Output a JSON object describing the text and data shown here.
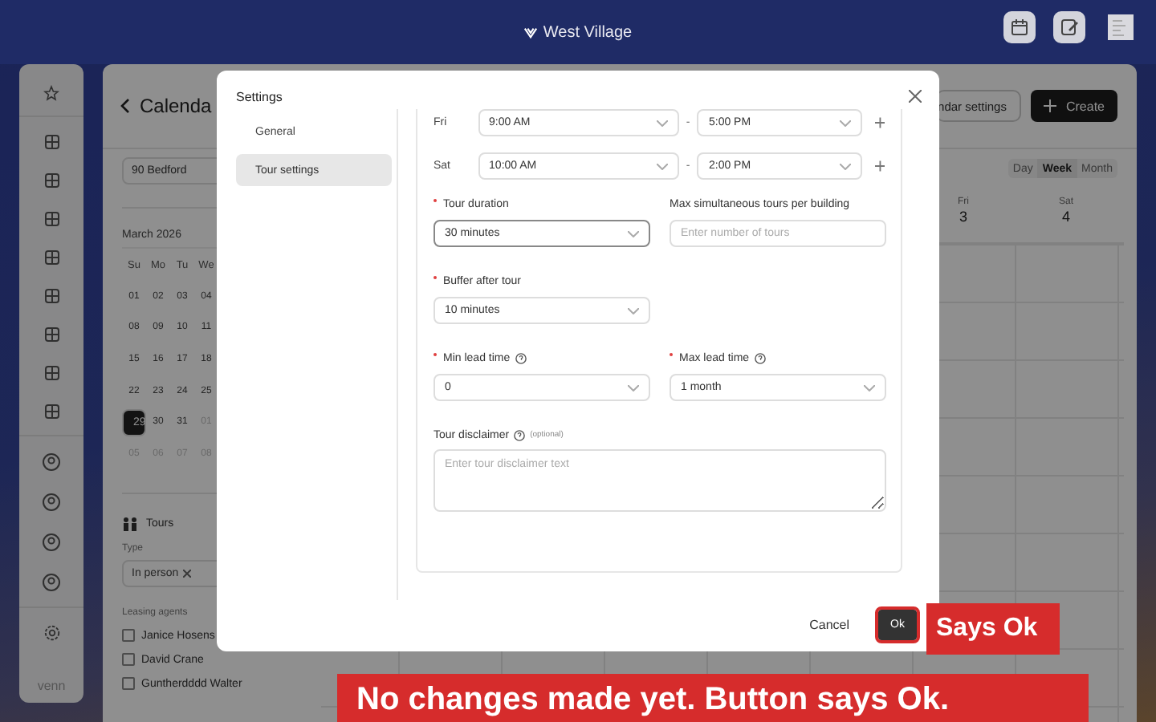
{
  "top_bar": {
    "location": "West Village"
  },
  "sidebar": {
    "brand": "venn"
  },
  "calendar_page": {
    "title": "Calenda",
    "settings_button": "ndar settings",
    "create_button": "Create",
    "building_filter": "90 Bedford",
    "mini_calendar": {
      "month": "March 2026",
      "weekdays": [
        "Su",
        "Mo",
        "Tu",
        "We"
      ],
      "days": [
        {
          "label": "01",
          "selected": false,
          "muted": false
        },
        {
          "label": "02",
          "selected": false,
          "muted": false
        },
        {
          "label": "03",
          "selected": false,
          "muted": false
        },
        {
          "label": "04",
          "selected": false,
          "muted": false
        },
        {
          "label": "08",
          "selected": false,
          "muted": false
        },
        {
          "label": "09",
          "selected": false,
          "muted": false
        },
        {
          "label": "10",
          "selected": false,
          "muted": false
        },
        {
          "label": "11",
          "selected": false,
          "muted": false
        },
        {
          "label": "15",
          "selected": false,
          "muted": false
        },
        {
          "label": "16",
          "selected": false,
          "muted": false
        },
        {
          "label": "17",
          "selected": false,
          "muted": false
        },
        {
          "label": "18",
          "selected": false,
          "muted": false
        },
        {
          "label": "22",
          "selected": false,
          "muted": false
        },
        {
          "label": "23",
          "selected": false,
          "muted": false
        },
        {
          "label": "24",
          "selected": false,
          "muted": false
        },
        {
          "label": "25",
          "selected": false,
          "muted": false
        },
        {
          "label": "29",
          "selected": true,
          "muted": false
        },
        {
          "label": "30",
          "selected": false,
          "muted": false
        },
        {
          "label": "31",
          "selected": false,
          "muted": false
        },
        {
          "label": "01",
          "selected": false,
          "muted": true
        },
        {
          "label": "05",
          "selected": false,
          "muted": true
        },
        {
          "label": "06",
          "selected": false,
          "muted": true
        },
        {
          "label": "07",
          "selected": false,
          "muted": true
        },
        {
          "label": "08",
          "selected": false,
          "muted": true
        }
      ]
    },
    "tours": {
      "title": "Tours",
      "type_label": "Type",
      "type_chips": [
        "In person"
      ],
      "agents_label": "Leasing agents",
      "agents": [
        {
          "name": "Janice Hosens",
          "checked": false
        },
        {
          "name": "David Crane",
          "checked": false
        },
        {
          "name": "Guntherdddd Walter",
          "checked": false
        }
      ]
    },
    "view_tabs": [
      {
        "label": "Day",
        "selected": false
      },
      {
        "label": "Week",
        "selected": true
      },
      {
        "label": "Month",
        "selected": false
      }
    ],
    "day_columns": [
      {
        "weekday": "Fri",
        "date": "3"
      },
      {
        "weekday": "Sat",
        "date": "4"
      }
    ]
  },
  "settings_modal": {
    "title": "Settings",
    "nav": [
      {
        "label": "General",
        "selected": false
      },
      {
        "label": "Tour settings",
        "selected": true
      }
    ],
    "hours": [
      {
        "day": "Fri",
        "from": "9:00 AM",
        "separator": "-",
        "to": "5:00 PM"
      },
      {
        "day": "Sat",
        "from": "10:00 AM",
        "separator": "-",
        "to": "2:00 PM"
      }
    ],
    "field_rows": [
      [
        {
          "kind": "select",
          "label": "Tour duration",
          "required": true,
          "help": false,
          "value": "30 minutes",
          "focused": true
        },
        {
          "kind": "input",
          "label": "Max simultaneous tours per building",
          "required": false,
          "help": false,
          "placeholder": "Enter number of tours",
          "focused": false
        }
      ],
      [
        {
          "kind": "select",
          "label": "Buffer after tour",
          "required": true,
          "help": false,
          "value": "10 minutes",
          "focused": false
        }
      ],
      [
        {
          "kind": "select",
          "label": "Min lead time",
          "required": true,
          "help": true,
          "value": "0",
          "focused": false
        },
        {
          "kind": "select",
          "label": "Max lead time",
          "required": true,
          "help": true,
          "value": "1 month",
          "focused": false
        }
      ]
    ],
    "disclaimer": {
      "label": "Tour disclaimer",
      "note": "(optional)",
      "placeholder": "Enter tour disclaimer text"
    },
    "cancel_button": "Cancel",
    "ok_button": {
      "label": "Ok",
      "highlighted": true
    }
  },
  "annotations": [
    {
      "kind": "small",
      "text": "Says Ok"
    },
    {
      "kind": "banner",
      "text": "No changes made yet. Button says Ok."
    }
  ]
}
